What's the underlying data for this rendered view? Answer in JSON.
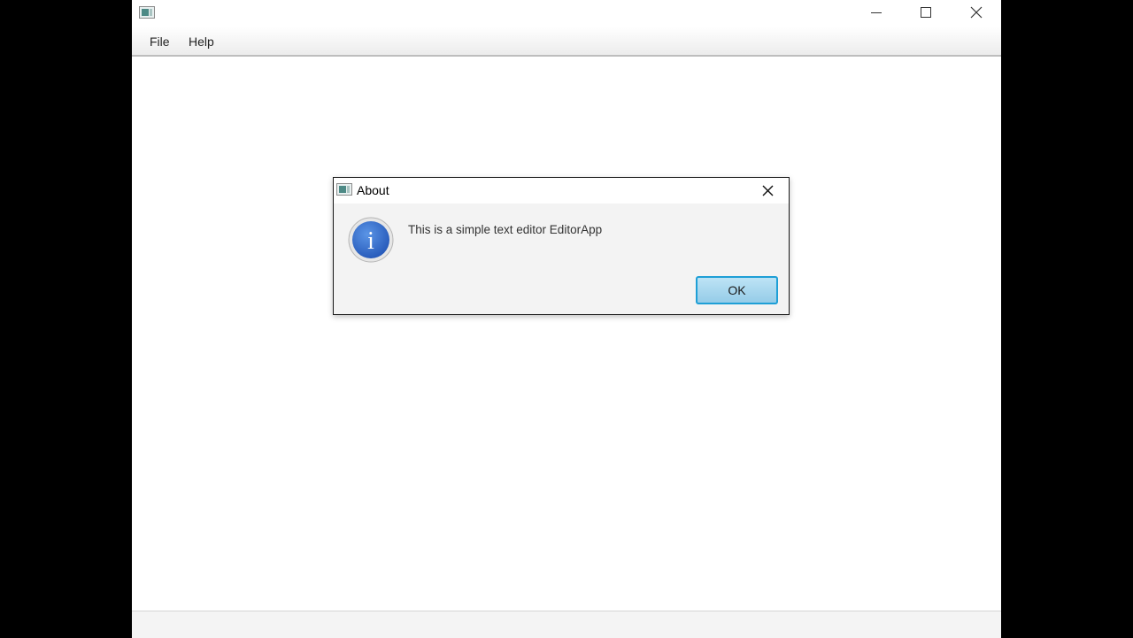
{
  "window": {
    "title": "",
    "controls": [
      "minimize-icon",
      "maximize-icon",
      "close-icon"
    ]
  },
  "menubar": {
    "items": [
      {
        "label": "File"
      },
      {
        "label": "Help"
      }
    ]
  },
  "dialog": {
    "title": "About",
    "icon": "info-icon",
    "message": "This is a simple text editor EditorApp",
    "ok_label": "OK",
    "info_glyph": "i"
  },
  "colors": {
    "accent": "#1e9fd6",
    "info_blue": "#2f6fd0",
    "background": "#000000"
  }
}
